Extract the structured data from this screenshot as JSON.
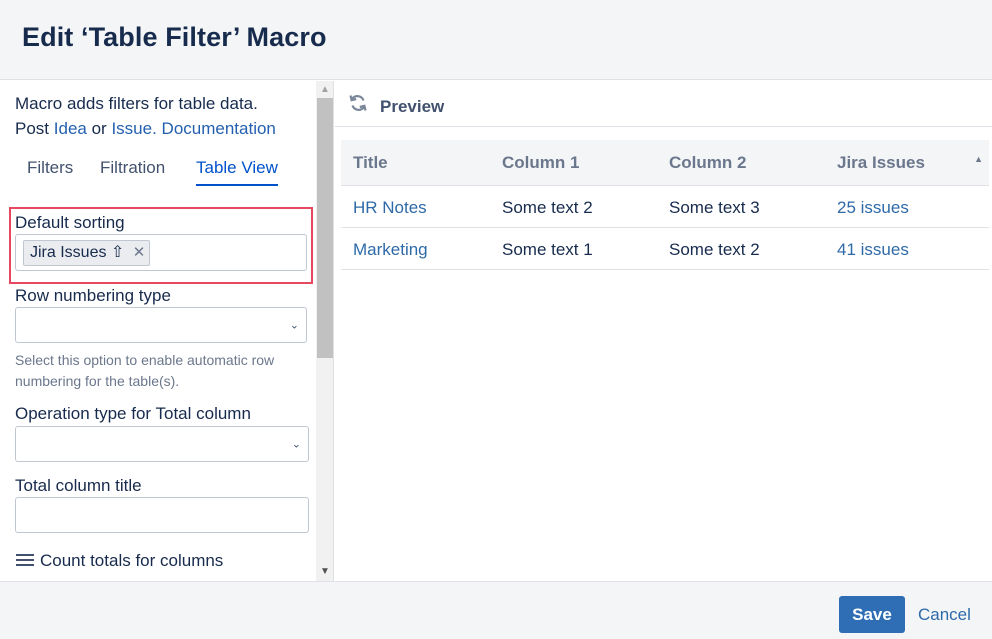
{
  "dialog": {
    "title": "Edit ‘Table Filter’ Macro"
  },
  "left_panel": {
    "intro_line1": "Macro adds filters for table data.",
    "intro_post": "Post",
    "intro_idea": "Idea",
    "intro_or": "or",
    "intro_issue": "Issue.",
    "intro_documentation": "Documentation",
    "tabs": [
      {
        "label": "Filters"
      },
      {
        "label": "Filtration"
      },
      {
        "label": "Table View",
        "active": true
      }
    ],
    "default_sorting": {
      "label": "Default sorting",
      "tag": "Jira Issues ⇧",
      "tag_remove": "✕"
    },
    "row_numbering": {
      "label": "Row numbering type",
      "value": "",
      "help": "Select this option to enable automatic row numbering for the table(s)."
    },
    "operation_type": {
      "label": "Operation type for Total column",
      "value": ""
    },
    "total_title": {
      "label": "Total column title",
      "value": ""
    },
    "count_totals": {
      "label": "Count totals for columns",
      "icon": "hamburger-icon"
    }
  },
  "preview": {
    "label": "Preview",
    "icon": "refresh-icon",
    "columns": [
      "Title",
      "Column 1",
      "Column 2",
      "Jira Issues"
    ],
    "rows": [
      {
        "title": "HR Notes",
        "col1": "Some text 2",
        "col2": "Some text 3",
        "jira": "25 issues"
      },
      {
        "title": "Marketing",
        "col1": "Some text 1",
        "col2": "Some text 2",
        "jira": "41 issues"
      }
    ]
  },
  "footer": {
    "save": "Save",
    "cancel": "Cancel"
  },
  "colors": {
    "accent": "#0052cc",
    "link": "#2e6aa8",
    "highlight": "#e5485f",
    "save_button": "#2f6eb5"
  }
}
